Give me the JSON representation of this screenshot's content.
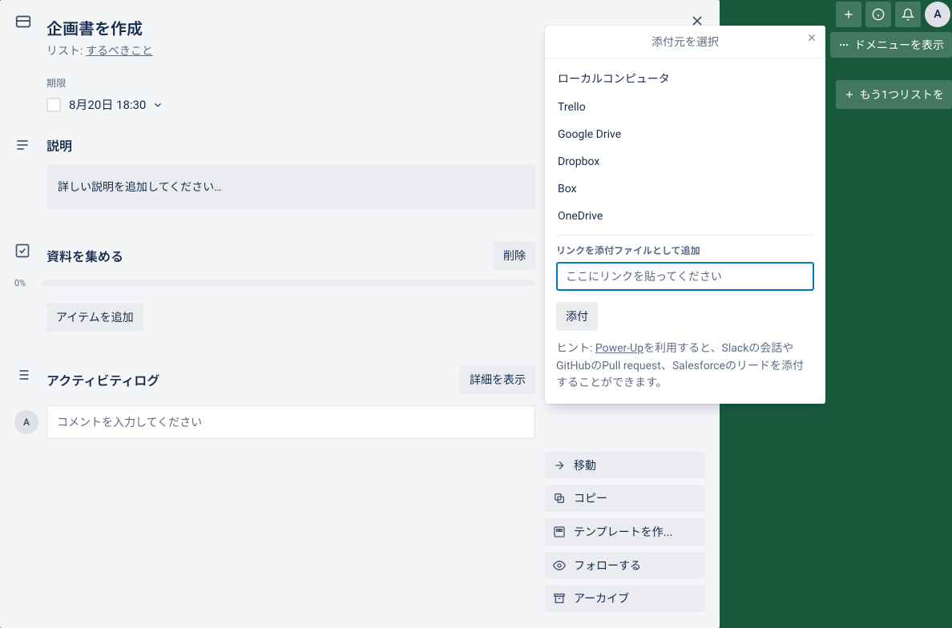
{
  "card": {
    "title": "企画書を作成",
    "list_prefix": "リスト:",
    "list_name": "するべきこと",
    "due_label": "期限",
    "due_value": "8月20日 18:30"
  },
  "description": {
    "heading": "説明",
    "placeholder": "詳しい説明を追加してください…"
  },
  "checklist": {
    "title": "資料を集める",
    "delete_label": "削除",
    "progress_pct": "0%",
    "add_item_label": "アイテムを追加"
  },
  "activity": {
    "heading": "アクティビティログ",
    "show_details_label": "詳細を表示",
    "avatar_initial": "A",
    "comment_placeholder": "コメントを入力してください"
  },
  "actions": {
    "move": "移動",
    "copy": "コピー",
    "template": "テンプレートを作...",
    "follow": "フォローする",
    "archive": "アーカイブ"
  },
  "popover": {
    "title": "添付元を選択",
    "sources": [
      "ローカルコンピュータ",
      "Trello",
      "Google Drive",
      "Dropbox",
      "Box",
      "OneDrive"
    ],
    "link_section_label": "リンクを添付ファイルとして追加",
    "link_placeholder": "ここにリンクを貼ってください",
    "attach_label": "添付",
    "hint_prefix": "ヒント: ",
    "hint_link": "Power-Up",
    "hint_suffix": "を利用すると、Slackの会話やGitHubのPull request、Salesforceのリードを添付することができます。"
  },
  "board": {
    "menu_label": "ドメニューを表示",
    "add_list_label": "もう1つリストを",
    "avatar_initial": "A"
  }
}
